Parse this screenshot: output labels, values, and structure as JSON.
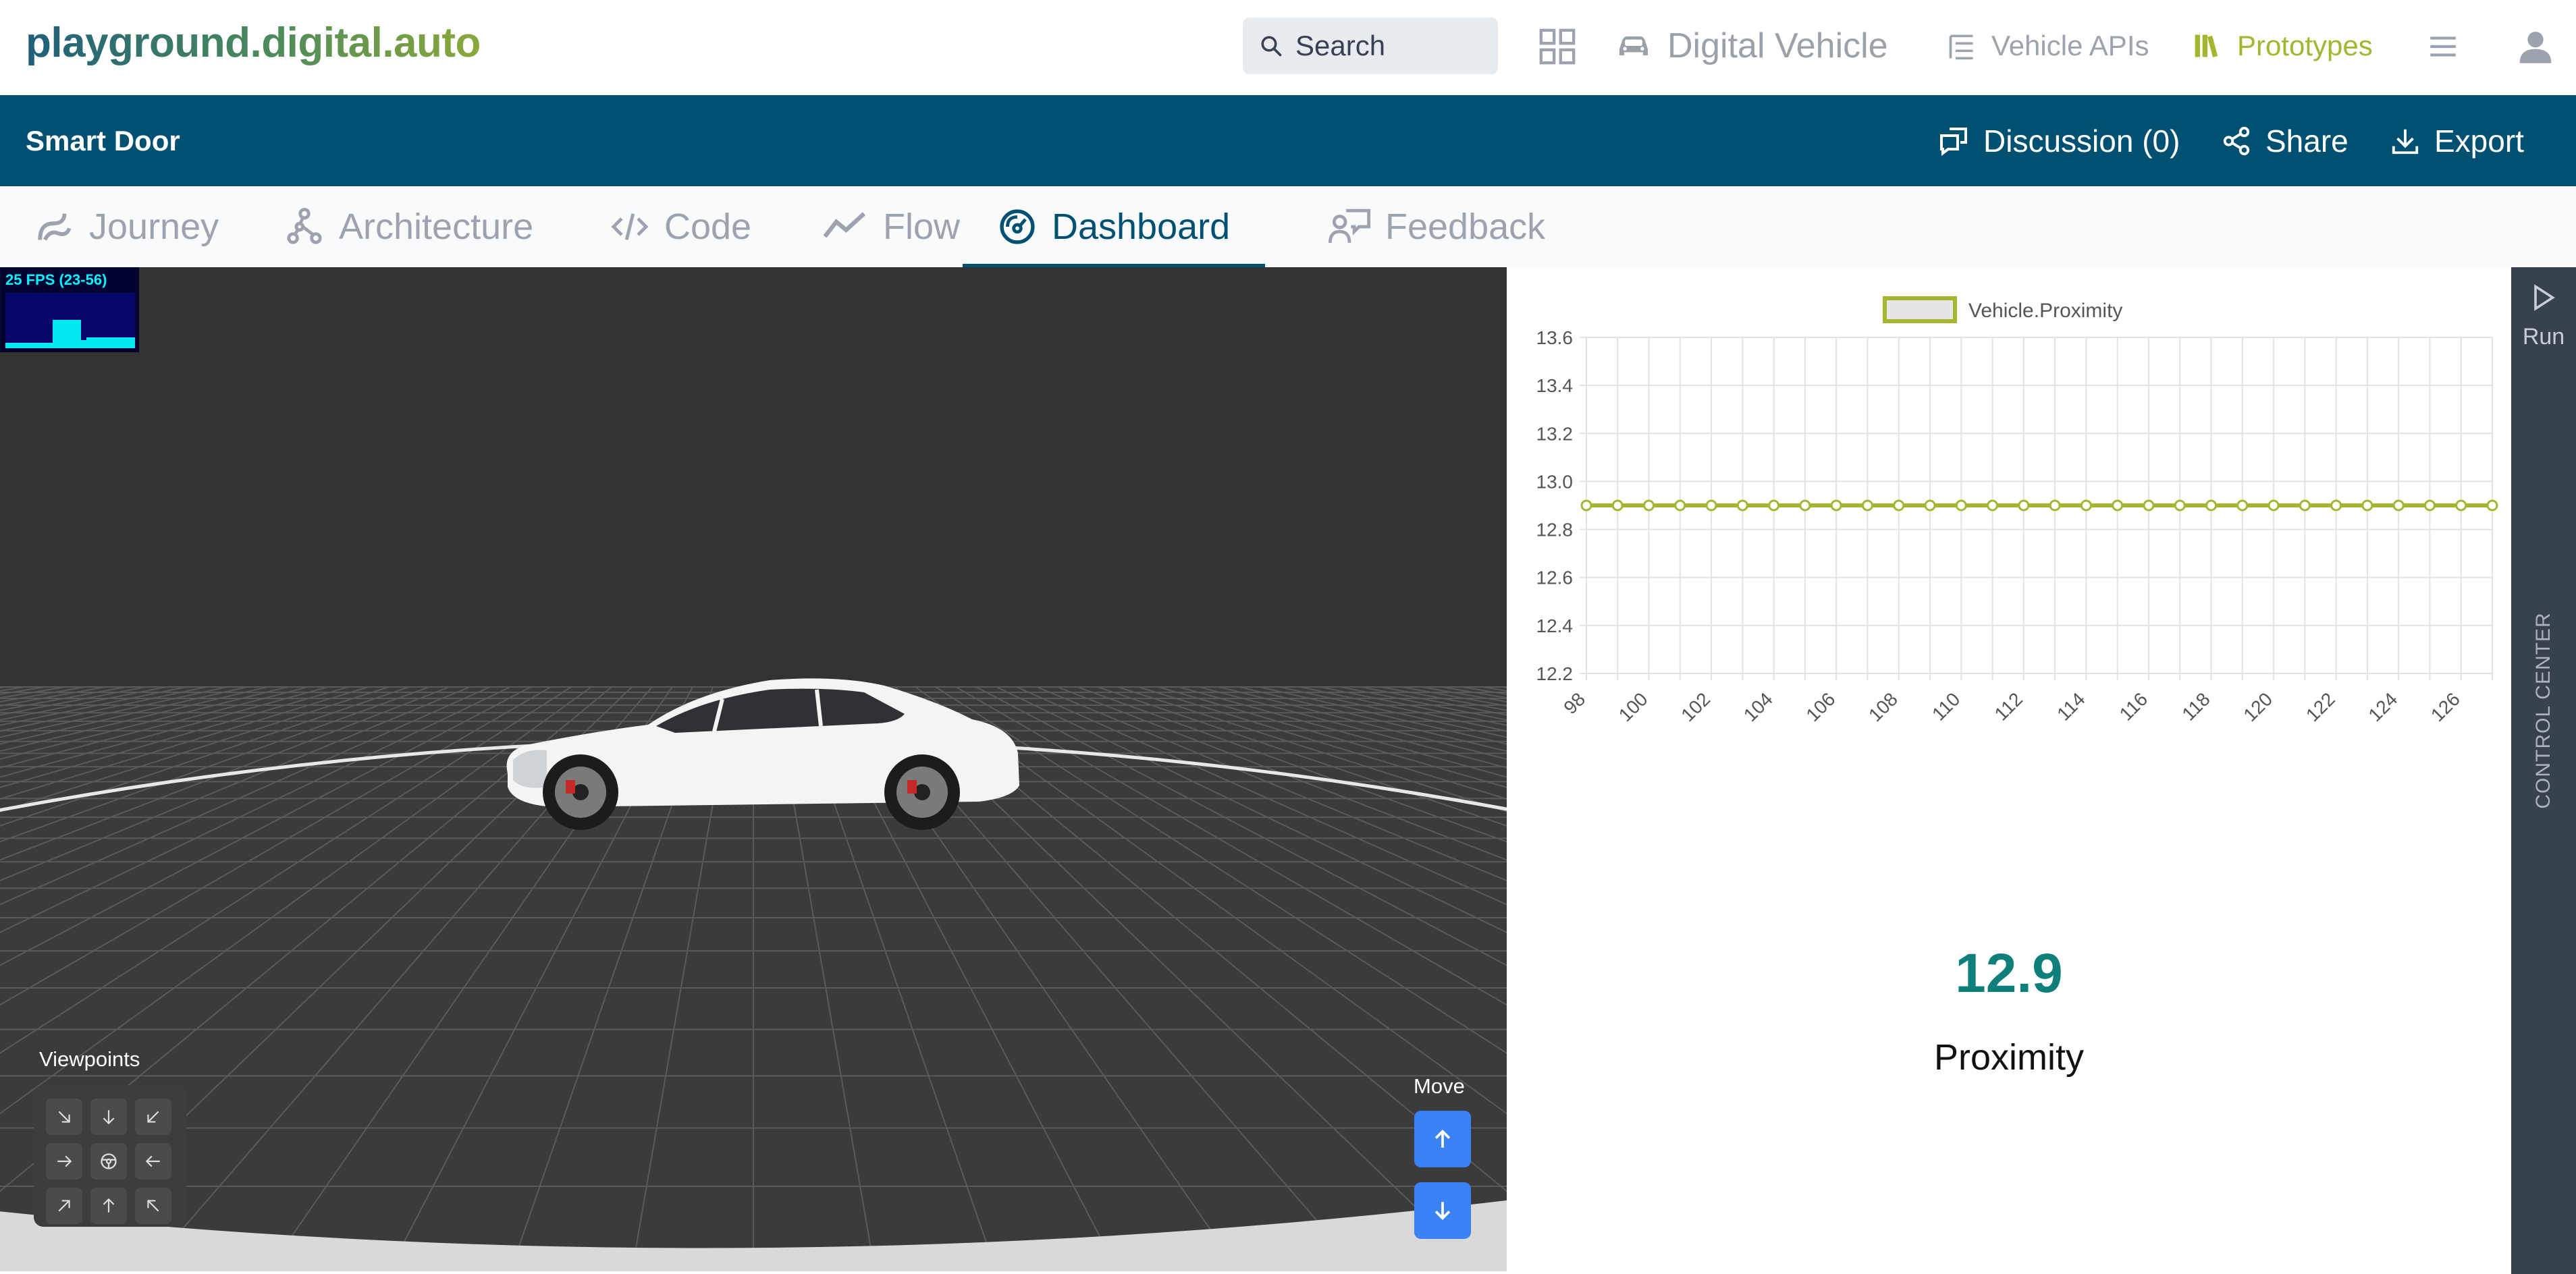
{
  "nav": {
    "logo": "playground.digital.auto",
    "search_placeholder": "Search",
    "items": [
      {
        "label": "Digital Vehicle",
        "icon": "car-icon"
      },
      {
        "label": "Vehicle APIs",
        "icon": "api-list-icon"
      },
      {
        "label": "Prototypes",
        "icon": "library-icon"
      }
    ]
  },
  "prototype": {
    "title": "Smart Door",
    "actions": [
      {
        "label": "Discussion (0)",
        "icon": "discussion-icon"
      },
      {
        "label": "Share",
        "icon": "share-icon"
      },
      {
        "label": "Export",
        "icon": "download-icon"
      }
    ]
  },
  "tabs": [
    {
      "label": "Journey",
      "active": false
    },
    {
      "label": "Architecture",
      "active": false
    },
    {
      "label": "Code",
      "active": false
    },
    {
      "label": "Flow",
      "active": false
    },
    {
      "label": "Dashboard",
      "active": true
    },
    {
      "label": "Feedback",
      "active": false
    }
  ],
  "view3d": {
    "fps_text": "25 FPS (23-56)",
    "viewpoints_label": "Viewpoints",
    "move_label": "Move"
  },
  "widget": {
    "value": "12.9",
    "label": "Proximity"
  },
  "control_center": {
    "run_label": "Run",
    "title": "CONTROL CENTER"
  },
  "colors": {
    "primary": "#005072",
    "line": "#a4b52f",
    "readout": "#0f7f7b",
    "accent_button": "#3b82f6"
  },
  "chart_data": {
    "type": "line",
    "x": [
      98,
      99,
      100,
      101,
      102,
      103,
      104,
      105,
      106,
      107,
      108,
      109,
      110,
      111,
      112,
      113,
      114,
      115,
      116,
      117,
      118,
      119,
      120,
      121,
      122,
      123,
      124,
      125,
      126,
      127
    ],
    "x_tick_labels": [
      "98",
      "100",
      "102",
      "104",
      "106",
      "108",
      "110",
      "112",
      "114",
      "116",
      "118",
      "120",
      "122",
      "124",
      "126"
    ],
    "y_tick_labels": [
      "13.6",
      "13.4",
      "13.2",
      "13.0",
      "12.8",
      "12.6",
      "12.4",
      "12.2"
    ],
    "ylim": [
      12.2,
      13.6
    ],
    "grid": true,
    "legend_position": "top",
    "series": [
      {
        "name": "Vehicle.Proximity",
        "values": [
          12.9,
          12.9,
          12.9,
          12.9,
          12.9,
          12.9,
          12.9,
          12.9,
          12.9,
          12.9,
          12.9,
          12.9,
          12.9,
          12.9,
          12.9,
          12.9,
          12.9,
          12.9,
          12.9,
          12.9,
          12.9,
          12.9,
          12.9,
          12.9,
          12.9,
          12.9,
          12.9,
          12.9,
          12.9,
          12.9
        ]
      }
    ]
  }
}
